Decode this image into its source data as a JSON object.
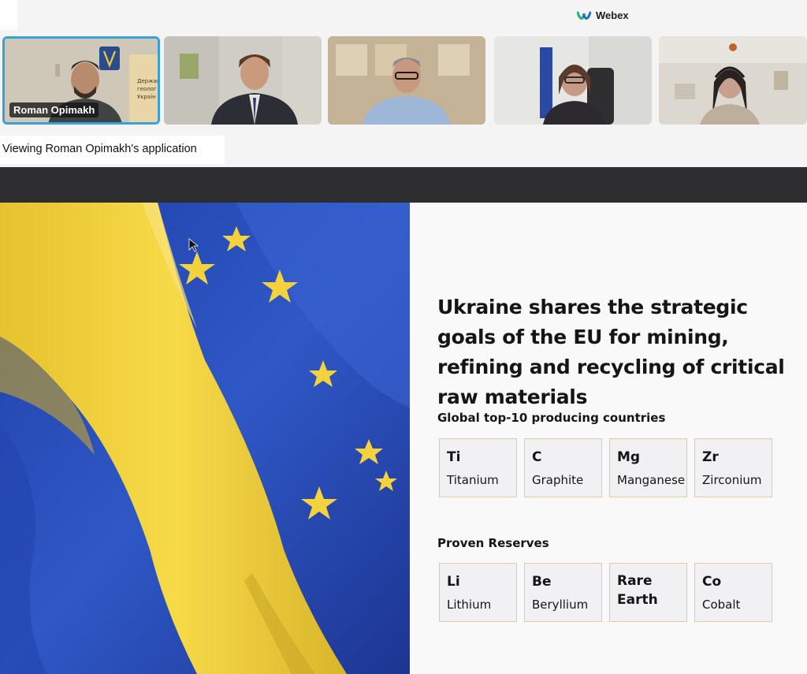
{
  "app": {
    "name": "Webex"
  },
  "participants": [
    {
      "name": "Roman Opimakh",
      "active": true
    },
    {
      "name": ""
    },
    {
      "name": ""
    },
    {
      "name": ""
    },
    {
      "name": ""
    }
  ],
  "share": {
    "viewing_label": "Viewing Roman Opimakh's application"
  },
  "slide": {
    "title": "Ukraine shares the strategic goals of the EU for mining, refining and recycling of critical raw materials",
    "sections": [
      {
        "label": "Global top-10 producing countries",
        "items": [
          {
            "symbol": "Ti",
            "element": "Titanium"
          },
          {
            "symbol": "C",
            "element": "Graphite"
          },
          {
            "symbol": "Mg",
            "element": "Manganese"
          },
          {
            "symbol": "Zr",
            "element": "Zirconium"
          }
        ]
      },
      {
        "label": "Proven Reserves",
        "items": [
          {
            "symbol": "Li",
            "element": "Lithium"
          },
          {
            "symbol": "Be",
            "element": "Beryllium"
          },
          {
            "symbol": "Rare Earth",
            "element": ""
          },
          {
            "symbol": "Co",
            "element": "Cobalt"
          }
        ]
      }
    ]
  },
  "colors": {
    "accent": "#3aa0d8",
    "card_border": "#e8c89c",
    "flag_blue": "#2a4cb8",
    "flag_yellow": "#f4d23e"
  },
  "icons": {
    "brand": "webex-logo-icon",
    "pointer": "mouse-pointer-icon"
  }
}
